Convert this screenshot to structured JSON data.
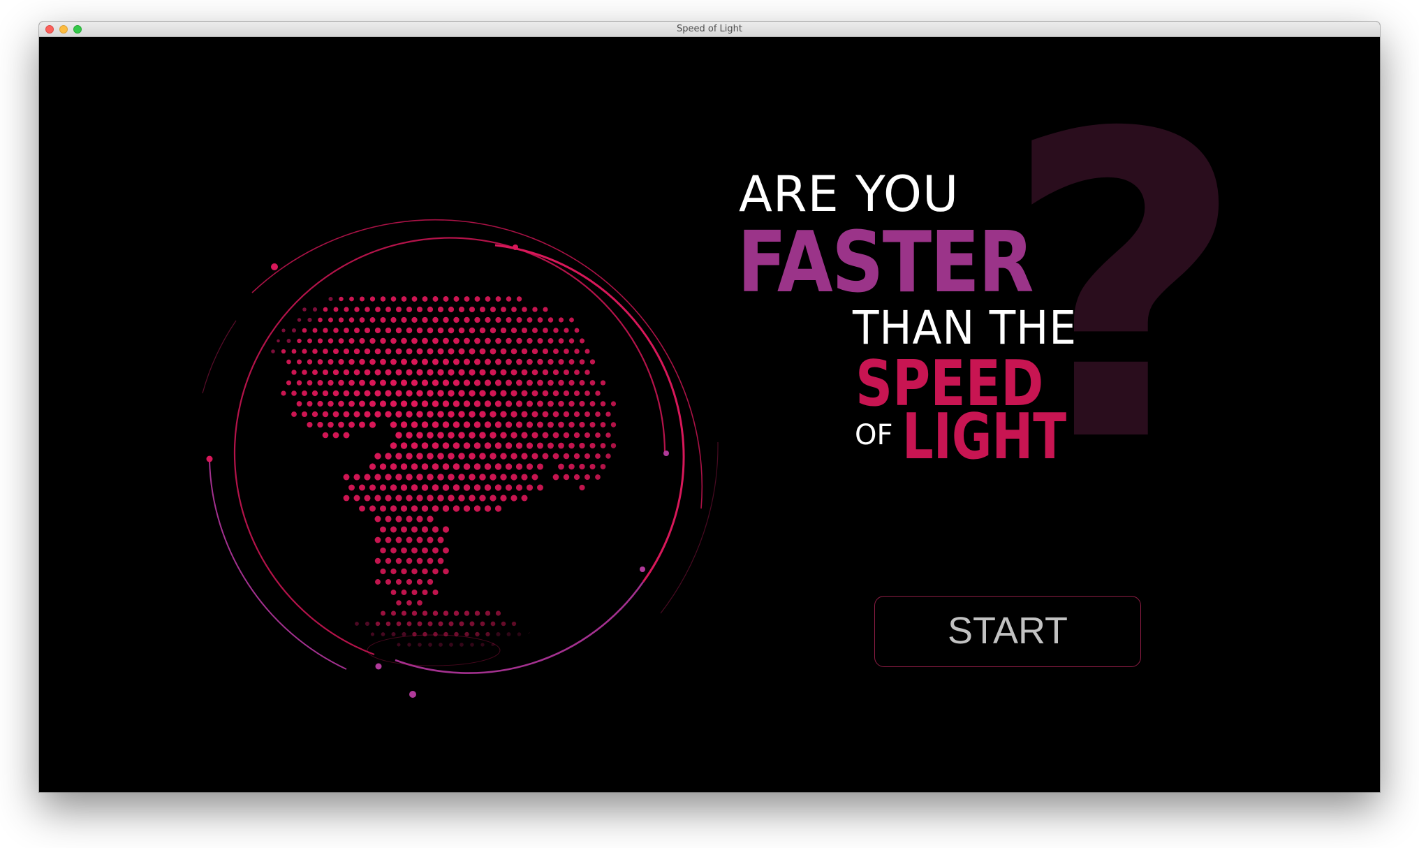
{
  "window": {
    "title": "Speed of Light"
  },
  "headline": {
    "line1": "ARE YOU",
    "line2": "FASTER",
    "line3": "THAN THE",
    "line4": "SPEED",
    "line5_small": "OF",
    "line5_big": "LIGHT",
    "question_mark": "?"
  },
  "start_button": {
    "label": "START"
  },
  "icons": {
    "globe": "dotted-globe-icon",
    "close": "close-dot",
    "minimize": "minimize-dot",
    "maximize": "maximize-dot"
  },
  "colors": {
    "background": "#000000",
    "magenta": "#c81552",
    "purple": "#9b3489",
    "question_mark": "#2a0d1d",
    "button_border": "#8f1d45",
    "button_text": "#c2c2c2"
  }
}
